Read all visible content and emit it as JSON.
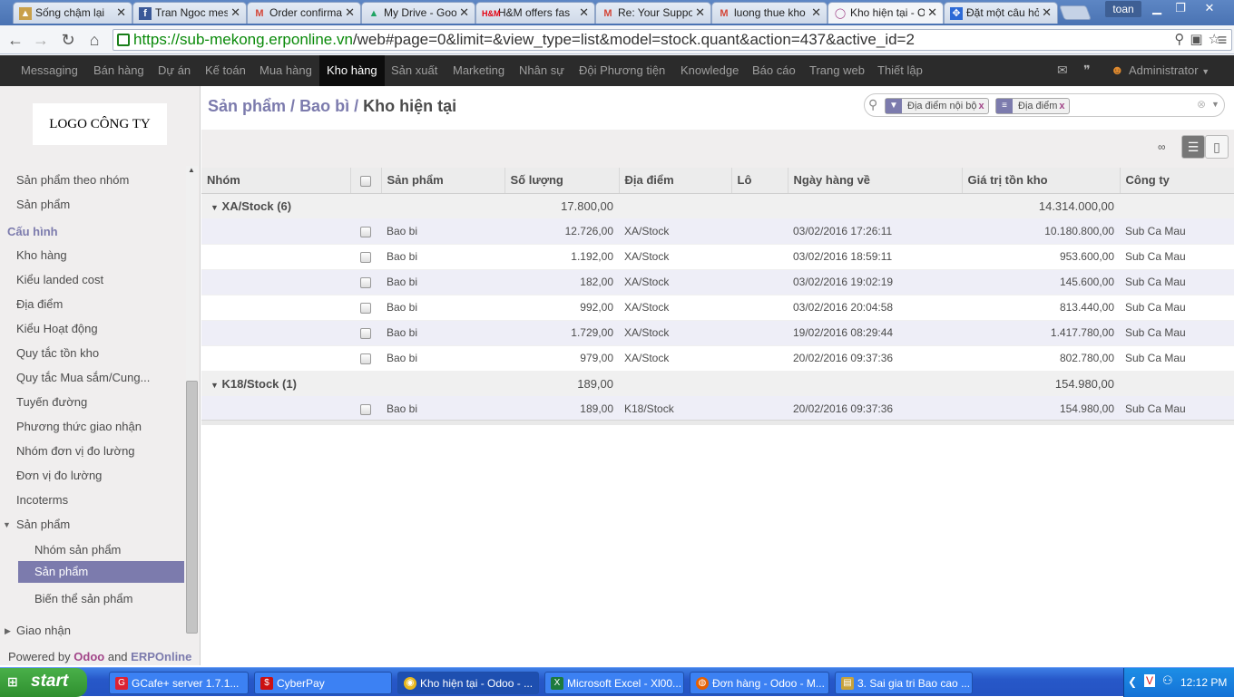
{
  "browser": {
    "tabs": [
      {
        "label": "Sống chậm lại",
        "icon": "photo-icon"
      },
      {
        "label": "Tran Ngoc mess",
        "icon": "facebook-icon"
      },
      {
        "label": "Order confirmat",
        "icon": "gmail-icon"
      },
      {
        "label": "My Drive - Goo",
        "icon": "drive-icon"
      },
      {
        "label": "H&M offers fas",
        "icon": "hm-icon"
      },
      {
        "label": "Re: Your Suppo",
        "icon": "gmail-icon"
      },
      {
        "label": "luong thue kho",
        "icon": "gmail-icon"
      },
      {
        "label": "Kho hiện tại - O",
        "icon": "odoo-icon"
      },
      {
        "label": "Đặt một câu hỏ",
        "icon": "stack-icon"
      }
    ],
    "profile": "toan",
    "url_host": "https://sub-mekong.erponline.vn",
    "url_path": "/web#page=0&limit=&view_type=list&model=stock.quant&action=437&active_id=2"
  },
  "topmenu": {
    "items": [
      "Messaging",
      "Bán hàng",
      "Dự án",
      "Kế toán",
      "Mua hàng",
      "Kho hàng",
      "Sản xuất",
      "Marketing",
      "Nhân sự",
      "Đội Phương tiện",
      "Knowledge",
      "Báo cáo",
      "Trang web",
      "Thiết lập"
    ],
    "active": "Kho hàng",
    "user": "Administrator"
  },
  "sidebar": {
    "logo": "LOGO CÔNG TY",
    "items_top": [
      "Sản phẩm theo nhóm",
      "Sản phẩm"
    ],
    "section": "Cấu hình",
    "config_items": [
      "Kho hàng",
      "Kiểu landed cost",
      "Địa điểm",
      "Kiểu Hoạt động",
      "Quy tắc tồn kho",
      "Quy tắc Mua sắm/Cung...",
      "Tuyến đường",
      "Phương thức giao nhận",
      "Nhóm đơn vị đo lường",
      "Đơn vị đo lường",
      "Incoterms"
    ],
    "product_group": "Sản phẩm",
    "product_sub": [
      "Nhóm sản phẩm",
      "Sản phẩm",
      "Biến thể sản phẩm"
    ],
    "selected": "Sản phẩm",
    "delivery": "Giao nhận",
    "powered_prefix": "Powered by",
    "powered_odoo": "Odoo",
    "powered_and": "and",
    "powered_erp": "ERPOnline"
  },
  "main": {
    "breadcrumb": [
      "Sản phẩm",
      "Bao bì",
      "Kho hiện tại"
    ],
    "facets": [
      {
        "label": "Địa điểm nội bộ",
        "icon": "filter-icon"
      },
      {
        "label": "Địa điểm",
        "icon": "group-icon"
      }
    ],
    "columns": [
      "Nhóm",
      "Sản phẩm",
      "Số lượng",
      "Địa điểm",
      "Lô",
      "Ngày hàng về",
      "Giá trị tồn kho",
      "Công ty"
    ],
    "groups": [
      {
        "label": "XA/Stock (6)",
        "qty": "17.800,00",
        "value": "14.314.000,00",
        "rows": [
          {
            "product": "Bao bi",
            "qty": "12.726,00",
            "location": "XA/Stock",
            "lot": "",
            "date": "03/02/2016 17:26:11",
            "value": "10.180.800,00",
            "company": "Sub Ca Mau"
          },
          {
            "product": "Bao bi",
            "qty": "1.192,00",
            "location": "XA/Stock",
            "lot": "",
            "date": "03/02/2016 18:59:11",
            "value": "953.600,00",
            "company": "Sub Ca Mau"
          },
          {
            "product": "Bao bi",
            "qty": "182,00",
            "location": "XA/Stock",
            "lot": "",
            "date": "03/02/2016 19:02:19",
            "value": "145.600,00",
            "company": "Sub Ca Mau"
          },
          {
            "product": "Bao bi",
            "qty": "992,00",
            "location": "XA/Stock",
            "lot": "",
            "date": "03/02/2016 20:04:58",
            "value": "813.440,00",
            "company": "Sub Ca Mau"
          },
          {
            "product": "Bao bi",
            "qty": "1.729,00",
            "location": "XA/Stock",
            "lot": "",
            "date": "19/02/2016 08:29:44",
            "value": "1.417.780,00",
            "company": "Sub Ca Mau"
          },
          {
            "product": "Bao bi",
            "qty": "979,00",
            "location": "XA/Stock",
            "lot": "",
            "date": "20/02/2016 09:37:36",
            "value": "802.780,00",
            "company": "Sub Ca Mau"
          }
        ]
      },
      {
        "label": "K18/Stock (1)",
        "qty": "189,00",
        "value": "154.980,00",
        "rows": [
          {
            "product": "Bao bi",
            "qty": "189,00",
            "location": "K18/Stock",
            "lot": "",
            "date": "20/02/2016 09:37:36",
            "value": "154.980,00",
            "company": "Sub Ca Mau"
          }
        ]
      }
    ]
  },
  "taskbar": {
    "start": "start",
    "items": [
      {
        "label": "GCafe+ server 1.7.1...",
        "icon": "gcafe-icon"
      },
      {
        "label": "CyberPay",
        "icon": "cyberpay-icon"
      },
      {
        "label": "Kho hiện tại - Odoo - ...",
        "icon": "chrome-icon"
      },
      {
        "label": "Microsoft Excel - Xl00...",
        "icon": "excel-icon"
      },
      {
        "label": "Đơn hàng - Odoo - M...",
        "icon": "firefox-icon"
      },
      {
        "label": "3. Sai gia tri Bao cao ...",
        "icon": "folder-icon"
      }
    ],
    "clock": "12:12 PM"
  }
}
